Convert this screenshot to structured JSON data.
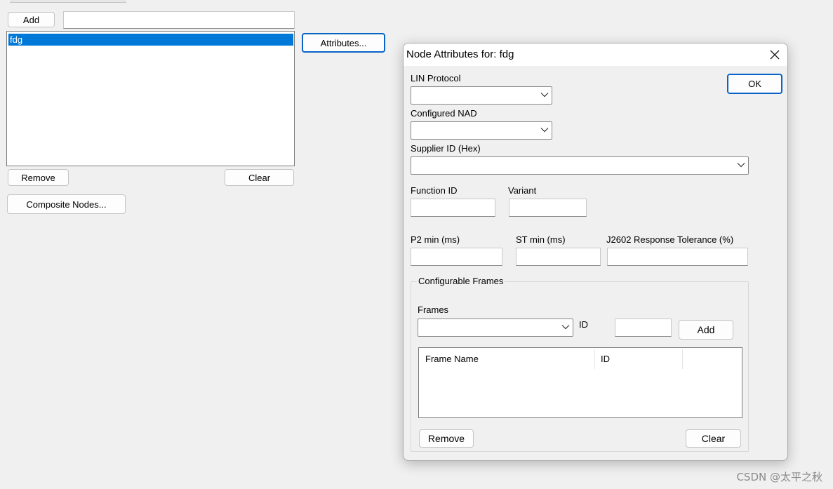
{
  "main": {
    "add_button": "Add",
    "add_input_value": "",
    "node_list": [
      "fdg"
    ],
    "attributes_button": "Attributes...",
    "remove_button": "Remove",
    "clear_button": "Clear",
    "composite_nodes_button": "Composite Nodes..."
  },
  "dialog": {
    "title": "Node Attributes for: fdg",
    "ok_button": "OK",
    "lin_protocol_label": "LIN Protocol",
    "lin_protocol_value": "",
    "configured_nad_label": "Configured NAD",
    "configured_nad_value": "",
    "supplier_id_label": "Supplier ID (Hex)",
    "supplier_id_value": "",
    "function_id_label": "Function ID",
    "function_id_value": "",
    "variant_label": "Variant",
    "variant_value": "",
    "p2_min_label": "P2 min (ms)",
    "p2_min_value": "",
    "st_min_label": "ST min (ms)",
    "st_min_value": "",
    "response_tolerance_label": "J2602 Response Tolerance (%)",
    "response_tolerance_value": "",
    "configurable_frames": {
      "group_title": "Configurable Frames",
      "frames_label": "Frames",
      "frames_value": "",
      "id_label": "ID",
      "id_value": "",
      "add_button": "Add",
      "columns": [
        "Frame Name",
        "ID"
      ],
      "rows": [],
      "remove_button": "Remove",
      "clear_button": "Clear"
    }
  },
  "watermark": "CSDN @太平之秋",
  "colors": {
    "selection": "#0078d7",
    "default_button_border": "#0a64c8",
    "window_bg": "#f0f0f0"
  }
}
